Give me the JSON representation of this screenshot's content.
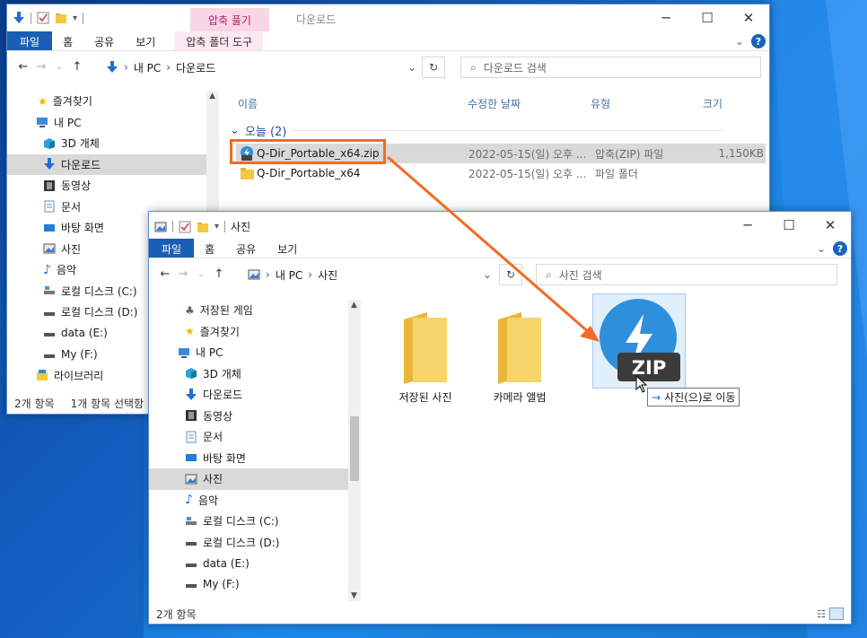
{
  "back": {
    "window_title": "다운로드",
    "context_tab": "압축 풀기",
    "ribbon_tabs": [
      "파일",
      "홈",
      "공유",
      "보기",
      "압축 폴더 도구"
    ],
    "address": {
      "pc": "내 PC",
      "folder": "다운로드"
    },
    "search_placeholder": "다운로드 검색",
    "nav": [
      "즐겨찾기",
      "내 PC",
      "3D 개체",
      "다운로드",
      "동영상",
      "문서",
      "바탕 화면",
      "사진",
      "음악",
      "로컬 디스크 (C:)",
      "로컬 디스크 (D:)",
      "data (E:)",
      "My (F:)",
      "라이브러리"
    ],
    "columns": {
      "name": "이름",
      "modified": "수정한 날짜",
      "type": "유형",
      "size": "크기"
    },
    "group_label": "오늘 (2)",
    "files": [
      {
        "name": "Q-Dir_Portable_x64.zip",
        "modified": "2022-05-15(일) 오후 ...",
        "type": "압축(ZIP) 파일",
        "size": "1,150KB"
      },
      {
        "name": "Q-Dir_Portable_x64",
        "modified": "2022-05-15(일) 오후 ...",
        "type": "파일 폴더",
        "size": ""
      }
    ],
    "status": {
      "count": "2개 항목",
      "selected": "1개 항목 선택함"
    }
  },
  "front": {
    "window_title": "사진",
    "ribbon_tabs": [
      "파일",
      "홈",
      "공유",
      "보기"
    ],
    "address": {
      "pc": "내 PC",
      "folder": "사진"
    },
    "search_placeholder": "사진 검색",
    "nav": [
      "저장된 게임",
      "즐겨찾기",
      "내 PC",
      "3D 개체",
      "다운로드",
      "동영상",
      "문서",
      "바탕 화면",
      "사진",
      "음악",
      "로컬 디스크 (C:)",
      "로컬 디스크 (D:)",
      "data (E:)",
      "My (F:)"
    ],
    "folders": [
      "저장된 사진",
      "카메라 앨범"
    ],
    "drag_label": "ZIP",
    "drop_tooltip": "사진(으)로 이동",
    "status": {
      "count": "2개 항목"
    }
  },
  "colors": {
    "accent": "#1a5fb4",
    "highlight": "#f26b22",
    "folder": "#f5c842",
    "zip_icon": "#2f8fdc"
  }
}
